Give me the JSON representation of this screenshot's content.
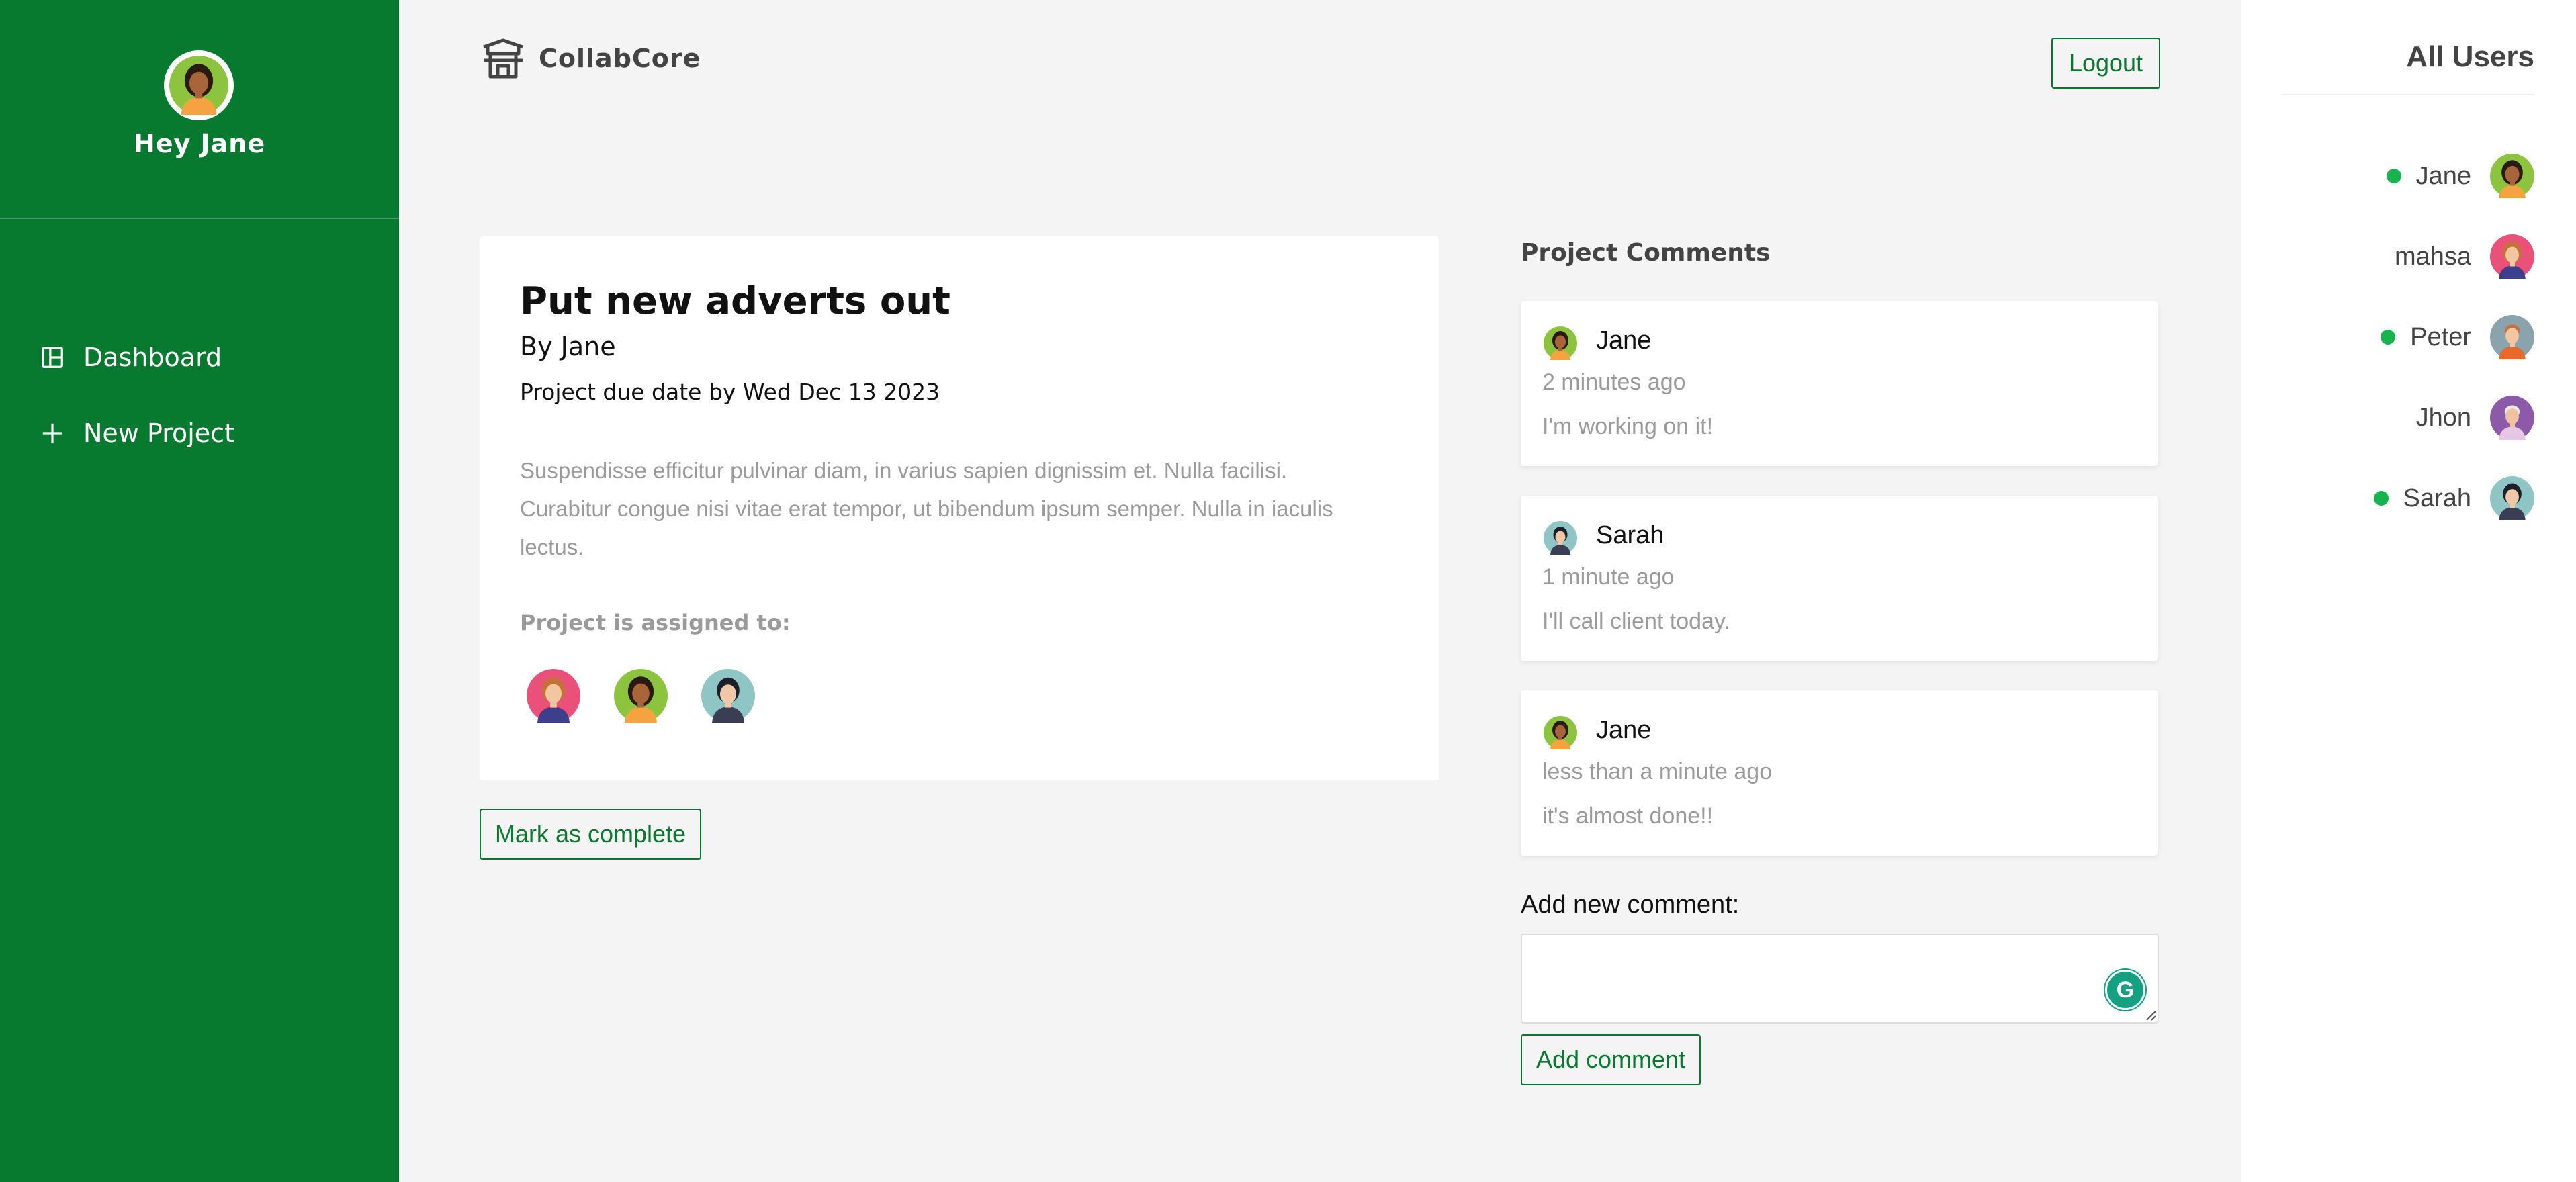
{
  "sidebar": {
    "greeting": "Hey Jane",
    "nav": [
      {
        "label": "Dashboard",
        "icon": "dashboard-icon"
      },
      {
        "label": "New Project",
        "icon": "plus-icon"
      }
    ]
  },
  "header": {
    "brand": "CollabCore",
    "logout_label": "Logout"
  },
  "project": {
    "title": "Put new adverts out",
    "author": "By Jane",
    "due": "Project due date by Wed Dec 13 2023",
    "description": "Suspendisse efficitur pulvinar diam, in varius sapien dignissim et. Nulla facilisi. Curabitur congue nisi vitae erat tempor, ut bibendum ipsum semper. Nulla in iaculis lectus.",
    "assigned_label": "Project is assigned to:",
    "assignees": [
      "mahsa",
      "Jane",
      "Sarah"
    ],
    "complete_label": "Mark as complete"
  },
  "comments": {
    "title": "Project Comments",
    "items": [
      {
        "name": "Jane",
        "time": "2 minutes ago",
        "text": "I'm working on it!"
      },
      {
        "name": "Sarah",
        "time": "1 minute ago",
        "text": "I'll call client today."
      },
      {
        "name": "Jane",
        "time": "less than a minute ago",
        "text": "it's almost done!!"
      }
    ],
    "add_label": "Add new comment:",
    "input_value": "",
    "grammarly_glyph": "G",
    "submit_label": "Add comment"
  },
  "users": {
    "title": "All Users",
    "list": [
      {
        "name": "Jane",
        "online": true
      },
      {
        "name": "mahsa",
        "online": false
      },
      {
        "name": "Peter",
        "online": true
      },
      {
        "name": "Jhon",
        "online": false
      },
      {
        "name": "Sarah",
        "online": true
      }
    ]
  },
  "colors": {
    "primary": "#087a30",
    "online": "#16b34f",
    "page_bg": "#f4f4f4"
  }
}
